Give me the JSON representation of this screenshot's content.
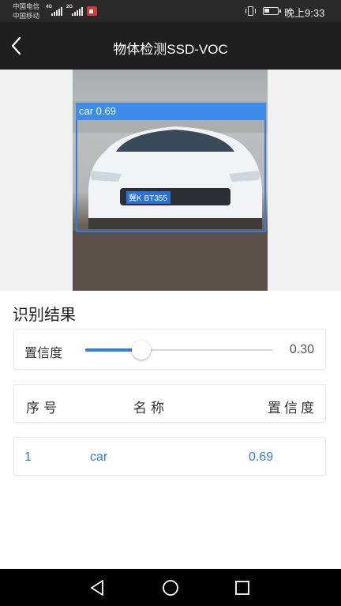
{
  "status_bar": {
    "carrier_1": "中国电信",
    "carrier_2": "中国移动",
    "network_1": "4G",
    "network_2": "2G",
    "time": "晚上9:33",
    "icons": [
      "signal-icon",
      "signal-icon",
      "screen-record-icon",
      "vibrate-icon",
      "battery-icon"
    ],
    "battery_level": 0.3
  },
  "header": {
    "title": "物体检测SSD-VOC",
    "back_icon": "chevron-left-icon"
  },
  "detection": {
    "label": "car 0.69",
    "plate_text": "冀K BT355",
    "box_color": "#2f7de0"
  },
  "results": {
    "title": "识别结果",
    "confidence_label": "置信度",
    "confidence_value": "0.30",
    "confidence_fraction": 0.3,
    "columns": [
      "序号",
      "名称",
      "置信度"
    ],
    "rows": [
      {
        "index": "1",
        "name": "car",
        "confidence": "0.69"
      }
    ]
  },
  "nav_bar": {
    "icons": [
      "nav-back-icon",
      "nav-home-icon",
      "nav-recent-icon"
    ]
  },
  "colors": {
    "accent": "#2f7fde",
    "header_bg": "#1f1f1f",
    "status_bg": "#2a2a2a"
  }
}
